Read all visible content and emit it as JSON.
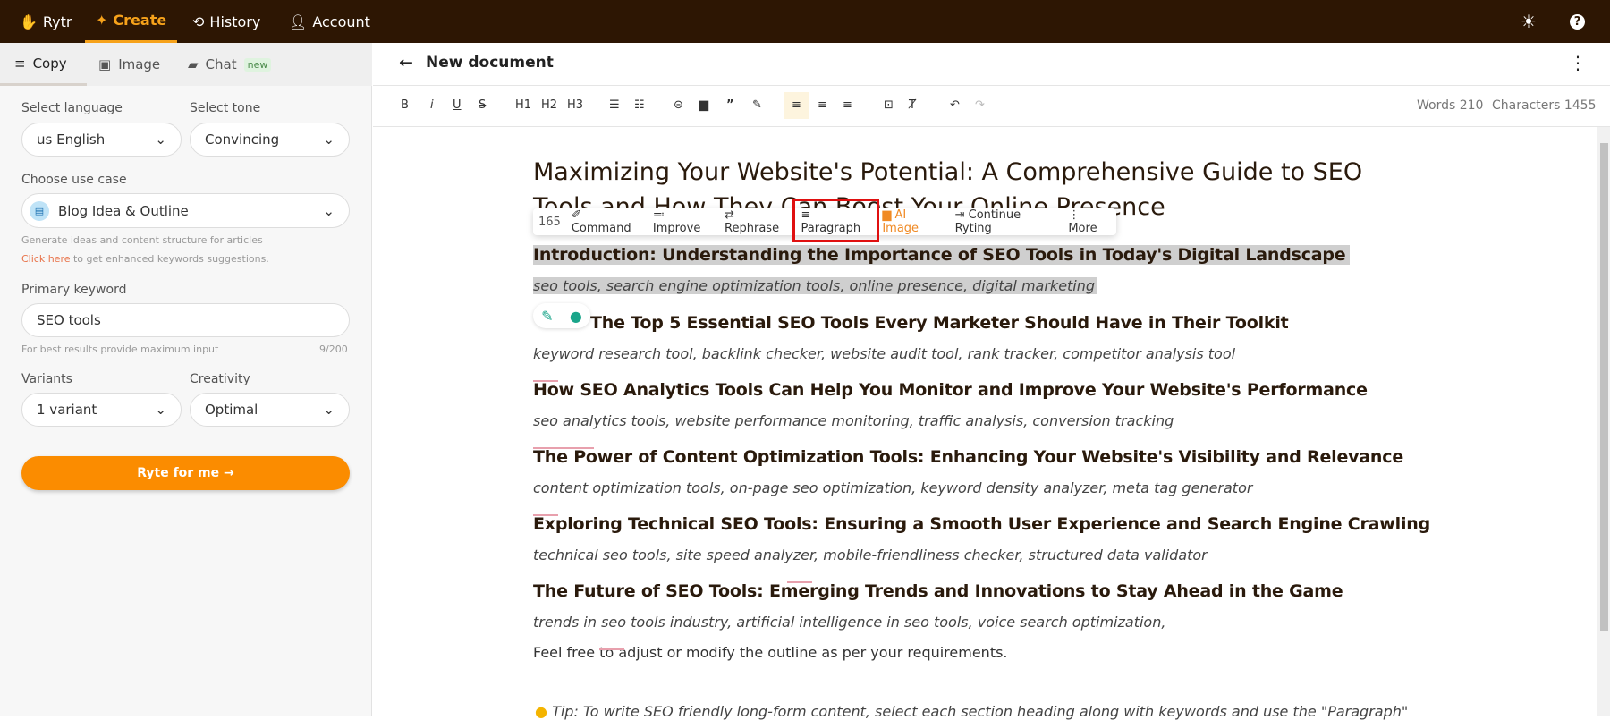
{
  "nav": {
    "brand": "Rytr",
    "items": [
      {
        "label": "Create",
        "icon": "sparkle-icon"
      },
      {
        "label": "History",
        "icon": "history-icon"
      },
      {
        "label": "Account",
        "icon": "user-icon"
      }
    ]
  },
  "tabs": [
    {
      "label": "Copy"
    },
    {
      "label": "Image"
    },
    {
      "label": "Chat",
      "badge": "new"
    }
  ],
  "form": {
    "language_label": "Select language",
    "language": "us English",
    "tone_label": "Select tone",
    "tone": "Convincing",
    "usecase_label": "Choose use case",
    "usecase": "Blog Idea & Outline",
    "usecase_hint": "Generate ideas and content structure for articles",
    "click_here": "Click here",
    "click_hint": " to get enhanced keywords suggestions.",
    "keyword_label": "Primary keyword",
    "keyword": "SEO tools",
    "keyword_hint": "For best results provide maximum input",
    "keyword_count": "9/200",
    "variants_label": "Variants",
    "variants": "1 variant",
    "creativity_label": "Creativity",
    "creativity": "Optimal",
    "ryte": "Ryte for me →"
  },
  "editor": {
    "title": "New document",
    "toolbar": {
      "b": "B",
      "i": "i",
      "u": "U",
      "s": "S",
      "h1": "H1",
      "h2": "H2",
      "h3": "H3"
    },
    "words": "Words 210",
    "chars": "Characters 1455",
    "doc_title_1": "Maximizing Your Website's Potential: A Comprehensive Guide to SEO",
    "doc_title_2": "Tools and How They Can Boost Your Online Presence",
    "floating": {
      "count": "165",
      "command": "Command",
      "improve": "Improve",
      "rephrase": "Rephrase",
      "paragraph": "Paragraph",
      "ai_image": "AI Image",
      "continue": "Continue Ryting",
      "more": "More"
    },
    "sections": [
      {
        "h": "Introduction: Understanding the Importance of SEO Tools in Today's Digital Landscape",
        "k": "seo tools, search engine optimization tools, online presence, digital marketing"
      },
      {
        "h": "The Top 5 Essential SEO Tools Every Marketer Should Have in Their Toolkit",
        "k": "keyword research tool, backlink checker, website audit tool, rank tracker, competitor analysis tool"
      },
      {
        "h": "How SEO Analytics Tools Can Help You Monitor and Improve Your Website's Performance",
        "k": "seo analytics tools, website performance monitoring, traffic analysis, conversion tracking"
      },
      {
        "h": "The Power of Content Optimization Tools: Enhancing Your Website's Visibility and Relevance",
        "k": "content optimization tools, on-page seo optimization, keyword density analyzer, meta tag generator"
      },
      {
        "h": "Exploring Technical SEO Tools: Ensuring a Smooth User Experience and Search Engine Crawling",
        "k": "technical seo tools, site speed analyzer, mobile-friendliness checker, structured data validator"
      },
      {
        "h": "The Future of SEO Tools: Emerging Trends and Innovations to Stay Ahead in the Game",
        "k": "trends in seo tools industry, artificial intelligence in seo tools, voice search optimization,"
      }
    ],
    "closing": "Feel free to adjust or modify the outline as per your requirements.",
    "tip": "Tip: To write SEO friendly long-form content, select each section heading along with keywords and use the \"Paragraph\""
  },
  "colors": {
    "topbar": "#2d1603",
    "accent": "#fb8c00",
    "highlight": "#red"
  }
}
